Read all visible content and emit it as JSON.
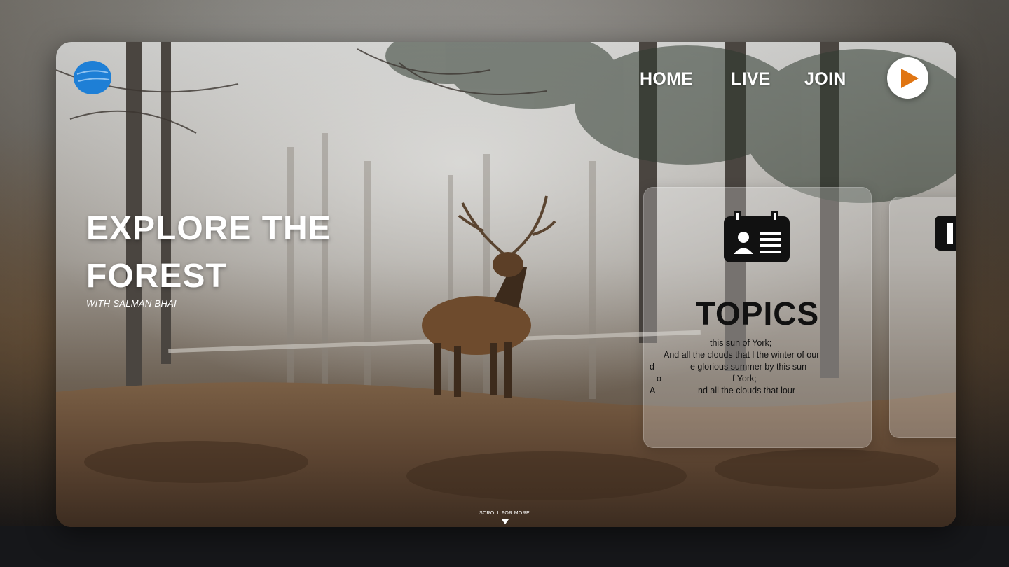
{
  "nav": {
    "items": [
      "HOME",
      "LIVE",
      "JOIN"
    ],
    "accent": "#e07512"
  },
  "logo": {
    "color": "#1e7fd6",
    "icon": "globe-logo-icon"
  },
  "hero": {
    "title": "EXPLORE THE FOREST",
    "subtitle": "WITH SALMAN BHAI"
  },
  "topic_card": {
    "icon": "id-card-icon",
    "title": "TOPICS",
    "lines": [
      "this sun of York;",
      "And all the clouds that l the winter of our",
      "d",
      "e glorious summer by this sun",
      "o",
      "f York;",
      "A",
      "nd all the clouds that lour"
    ]
  },
  "scroll_hint": "SCROLL FOR MORE"
}
